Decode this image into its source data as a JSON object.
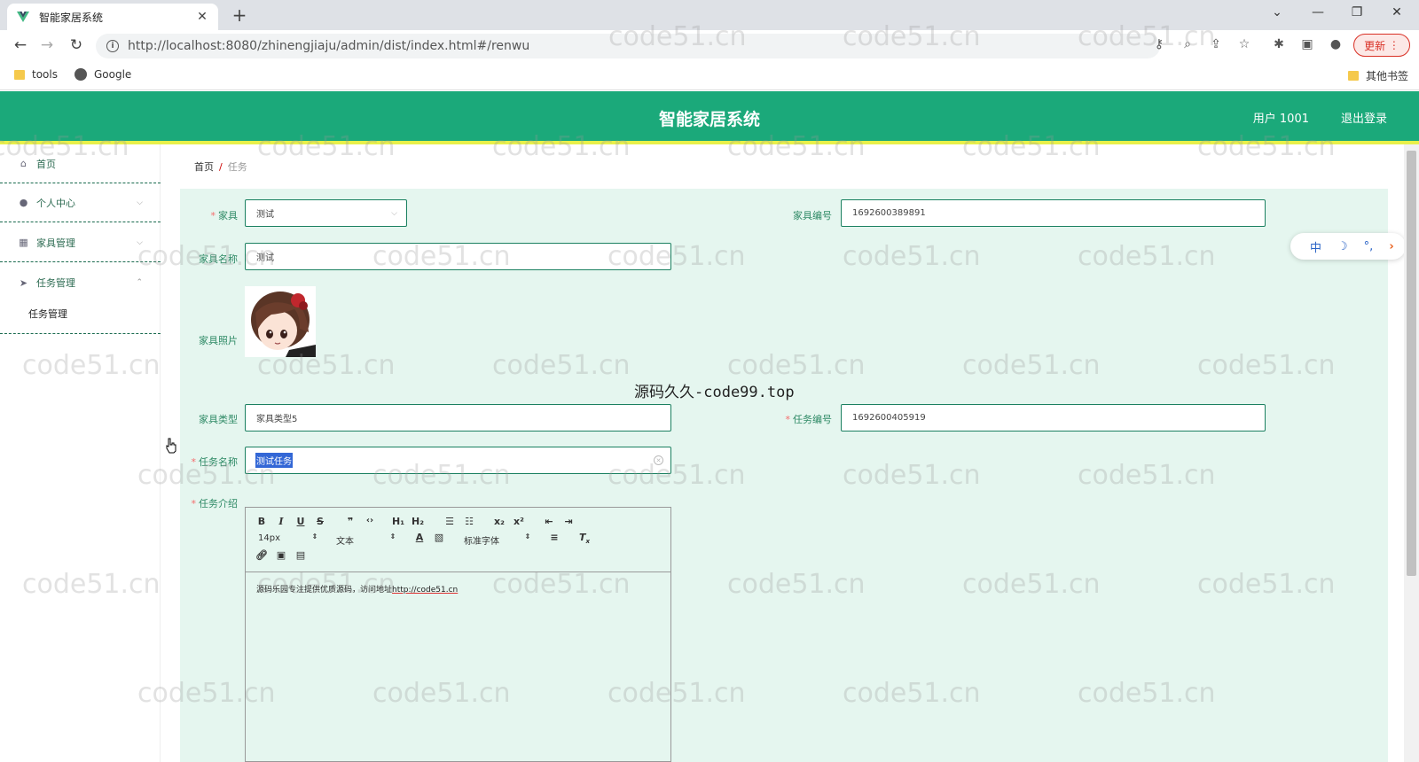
{
  "browser": {
    "tab_title": "智能家居系统",
    "url": "http://localhost:8080/zhinengjiaju/admin/dist/index.html#/renwu",
    "url_host": "localhost",
    "update_label": "更新",
    "bookmarks": [
      {
        "label": "tools"
      },
      {
        "label": "Google"
      }
    ],
    "other_bookmarks": "其他书签"
  },
  "header": {
    "title": "智能家居系统",
    "user": "用户 1001",
    "logout": "退出登录"
  },
  "sidebar": {
    "items": [
      {
        "label": "首页",
        "icon": "home-icon"
      },
      {
        "label": "个人中心",
        "icon": "user-icon"
      },
      {
        "label": "家具管理",
        "icon": "grid-icon"
      },
      {
        "label": "任务管理",
        "icon": "send-icon"
      }
    ],
    "sub_item": "任务管理"
  },
  "breadcrumb": {
    "home": "首页",
    "sep": "/",
    "current": "任务"
  },
  "form": {
    "furniture_label": "家具",
    "furniture_value": "测试",
    "furniture_no_label": "家具编号",
    "furniture_no_value": "1692600389891",
    "furniture_name_label": "家具名称",
    "furniture_name_value": "测试",
    "furniture_photo_label": "家具照片",
    "furniture_type_label": "家具类型",
    "furniture_type_value": "家具类型5",
    "task_no_label": "任务编号",
    "task_no_value": "1692600405919",
    "task_name_label": "任务名称",
    "task_name_value": "测试任务",
    "task_intro_label": "任务介绍"
  },
  "editor": {
    "font_size": "14px",
    "text_style": "文本",
    "font_family": "标准字体",
    "content": "源码乐园专注提供优质源码，访问地址",
    "content_link": "http://code51.cn",
    "toolbar_icons": [
      "bold-icon",
      "italic-icon",
      "underline-icon",
      "strike-icon",
      "quote-icon",
      "code-icon",
      "h1-icon",
      "h2-icon",
      "ordered-list-icon",
      "bullet-list-icon",
      "subscript-icon",
      "superscript-icon",
      "outdent-icon",
      "indent-icon",
      "color-icon",
      "background-icon",
      "align-icon",
      "clear-format-icon",
      "link-icon",
      "image-icon",
      "video-icon"
    ]
  },
  "overlay_text": "源码久久-code99.top",
  "float_bar": {
    "lang": "中",
    "moon": "☽",
    "dots": "°,",
    "arrow": "›"
  },
  "watermark": "code51.cn",
  "colors": {
    "header": "#1ba97a",
    "accent_line": "#e8f04a",
    "form_bg": "#e5f6ef",
    "label": "#2f8a66",
    "required": "#f56c6c"
  }
}
